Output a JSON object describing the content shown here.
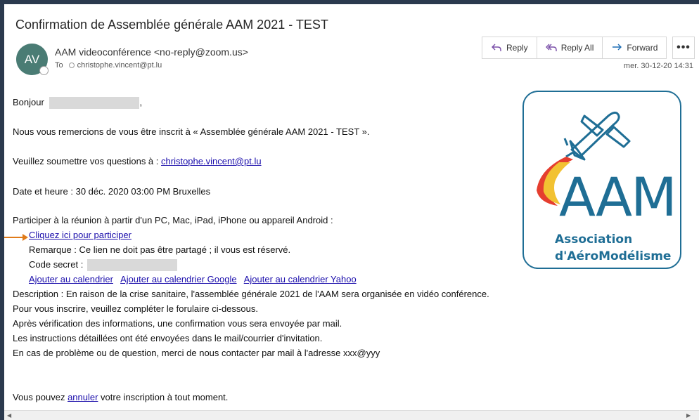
{
  "email": {
    "subject": "Confirmation de Assemblée générale AAM 2021 - TEST",
    "avatar_initials": "AV",
    "sender": "AAM videoconférence <no-reply@zoom.us>",
    "to_label": "To",
    "to_address": "christophe.vincent@pt.lu",
    "date": "mer. 30-12-20 14:31"
  },
  "actions": {
    "reply": "Reply",
    "reply_all": "Reply All",
    "forward": "Forward",
    "more": "•••"
  },
  "body": {
    "greeting": "Bonjour",
    "greeting_suffix": ",",
    "thanks": "Nous vous remercions de vous être inscrit à « Assemblée générale AAM 2021 - TEST ».",
    "questions_prefix": "Veuillez soumettre vos questions à : ",
    "questions_email": "christophe.vincent@pt.lu",
    "datetime": "Date et heure : 30 déc. 2020 03:00 PM Bruxelles",
    "join_intro": "Participer à la réunion à partir d'un PC, Mac, iPad, iPhone ou appareil Android :",
    "join_link": "Cliquez ici pour participer",
    "remark": "Remarque : Ce lien ne doit pas être partagé ; il vous est réservé.",
    "secret_label": "Code secret :",
    "calendar_links": [
      "Ajouter au calendrier",
      "Ajouter au calendrier Google",
      "Ajouter au calendrier Yahoo"
    ],
    "description": "Description : En raison de la crise sanitaire, l'assemblée générale 2021 de l'AAM sera organisée en vidéo conférence.",
    "line2": "Pour vous inscrire, veuillez compléter le forulaire ci-dessous.",
    "line3": "Après vérification des informations, une confirmation vous sera envoyée par mail.",
    "line4": "Les instructions détaillées ont été envoyées dans le mail/courrier d'invitation.",
    "line5": "En cas de problème ou de question, merci de nous contacter par mail à l'adresse xxx@yyy",
    "cancel_prefix": "Vous pouvez ",
    "cancel_link": "annuler",
    "cancel_suffix": " votre inscription à tout moment."
  },
  "logo": {
    "letters": "AAM",
    "line1": "Association",
    "line2": "d'AéroModélisme"
  },
  "colors": {
    "logo_blue": "#1f6e95",
    "link": "#1a0dab",
    "arrow": "#e07b1a",
    "avatar": "#4a7c74"
  }
}
